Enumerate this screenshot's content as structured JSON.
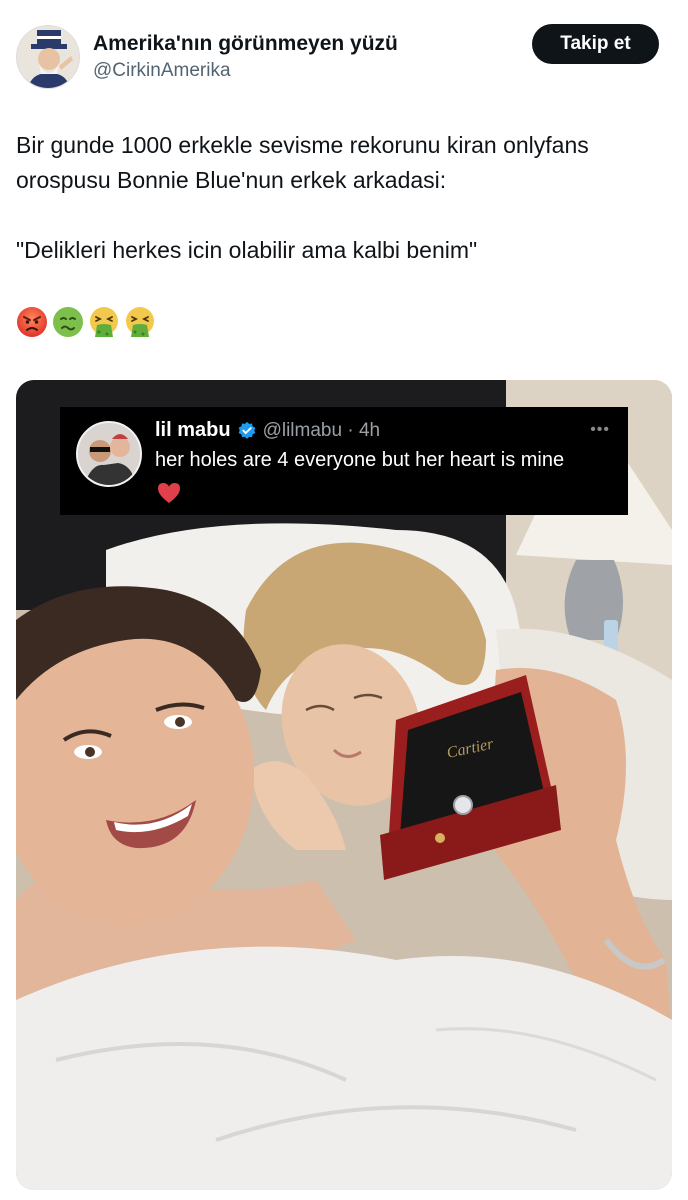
{
  "author": {
    "display_name": "Amerika'nın görünmeyen yüzü",
    "handle": "@CirkinAmerika",
    "follow_label": "Takip et"
  },
  "tweet": {
    "line1": "Bir gunde 1000 erkekle sevisme rekorunu kiran onlyfans orospusu Bonnie Blue'nun erkek arkadasi:",
    "quote": "\"Delikleri herkes icin olabilir ama kalbi benim\"",
    "emojis": [
      "angry-face-icon",
      "nauseated-face-icon",
      "vomiting-face-icon",
      "vomiting-face-icon"
    ]
  },
  "embedded_post": {
    "name": "lil mabu",
    "handle": "@lilmabu · 4h",
    "text": "her holes are 4 everyone but her heart is mine",
    "icons": [
      "verified-badge-icon",
      "more-icon",
      "heart-icon"
    ]
  },
  "photo": {
    "box_brand": "Cartier"
  },
  "colors": {
    "text": "#0f1419",
    "secondary": "#536471",
    "follow_bg": "#0f1419",
    "verified": "#1d9bf0",
    "heart": "#e0404a"
  }
}
